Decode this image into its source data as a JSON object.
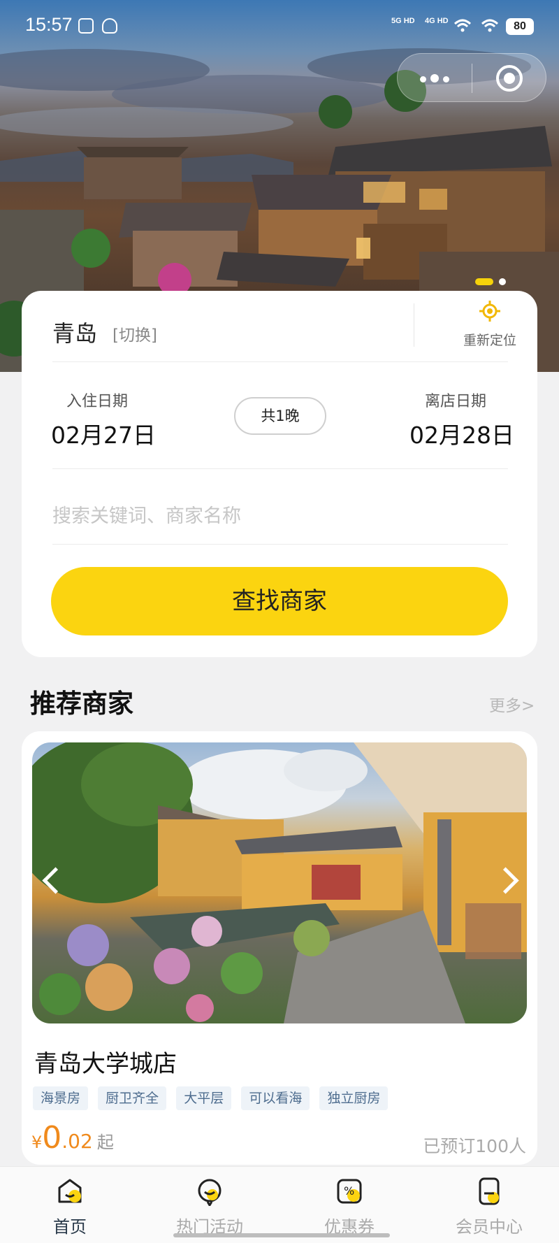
{
  "status_bar": {
    "time": "15:57",
    "net1": "5G HD",
    "net2": "4G HD",
    "battery": "80"
  },
  "location": {
    "city": "青岛",
    "switch_label": "[切换]",
    "relocate_label": "重新定位"
  },
  "dates": {
    "checkin_label": "入住日期",
    "checkin_value": "02月27日",
    "nights_label": "共1晚",
    "checkout_label": "离店日期",
    "checkout_value": "02月28日"
  },
  "search": {
    "placeholder": "搜索关键词、商家名称",
    "button_label": "查找商家"
  },
  "recommend": {
    "title": "推荐商家",
    "more_label": "更多>"
  },
  "store": {
    "name": "青岛大学城店",
    "tags": [
      "海景房",
      "厨卫齐全",
      "大平层",
      "可以看海",
      "独立厨房"
    ],
    "price_currency": "¥",
    "price_int": "0",
    "price_dec": ".02",
    "price_suffix": "起",
    "booked": "已预订100人"
  },
  "tabbar": {
    "items": [
      {
        "label": "首页",
        "icon": "home-icon",
        "active": true
      },
      {
        "label": "热门活动",
        "icon": "activity-icon",
        "active": false
      },
      {
        "label": "优惠券",
        "icon": "coupon-icon",
        "active": false
      },
      {
        "label": "会员中心",
        "icon": "member-icon",
        "active": false
      }
    ]
  },
  "colors": {
    "accent": "#fbd410",
    "price": "#f08a1c",
    "tag_bg": "#eef3f8",
    "tag_text": "#4d6c8e"
  }
}
